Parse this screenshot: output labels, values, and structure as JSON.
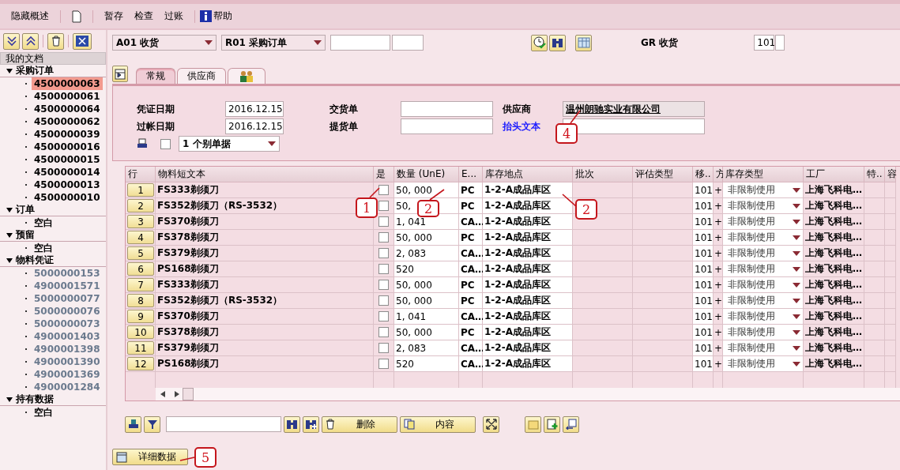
{
  "toolbar": {
    "hide_overview": "隐藏概述",
    "hold": "暂存",
    "check": "检查",
    "post": "过账",
    "help": "帮助"
  },
  "sidebar": {
    "title": "我的文档",
    "sections": [
      {
        "label": "采购订单",
        "expanded": true,
        "muted": false,
        "items": [
          {
            "label": "4500000063",
            "selected": true
          },
          {
            "label": "4500000061",
            "selected": false
          },
          {
            "label": "4500000064",
            "selected": false
          },
          {
            "label": "4500000062",
            "selected": false
          },
          {
            "label": "4500000039",
            "selected": false
          },
          {
            "label": "4500000016",
            "selected": false
          },
          {
            "label": "4500000015",
            "selected": false
          },
          {
            "label": "4500000014",
            "selected": false
          },
          {
            "label": "4500000013",
            "selected": false
          },
          {
            "label": "4500000010",
            "selected": false
          }
        ]
      },
      {
        "label": "订单",
        "expanded": true,
        "muted": false,
        "items": [
          {
            "label": "空白",
            "selected": false
          }
        ]
      },
      {
        "label": "预留",
        "expanded": true,
        "muted": false,
        "items": [
          {
            "label": "空白",
            "selected": false
          }
        ]
      },
      {
        "label": "物料凭证",
        "expanded": true,
        "muted": true,
        "items": [
          {
            "label": "5000000153",
            "selected": false
          },
          {
            "label": "4900001571",
            "selected": false
          },
          {
            "label": "5000000077",
            "selected": false
          },
          {
            "label": "5000000076",
            "selected": false
          },
          {
            "label": "5000000073",
            "selected": false
          },
          {
            "label": "4900001403",
            "selected": false
          },
          {
            "label": "4900001398",
            "selected": false
          },
          {
            "label": "4900001390",
            "selected": false
          },
          {
            "label": "4900001369",
            "selected": false
          },
          {
            "label": "4900001284",
            "selected": false
          }
        ]
      },
      {
        "label": "持有数据",
        "expanded": true,
        "muted": false,
        "items": [
          {
            "label": "空白",
            "selected": false
          }
        ]
      }
    ]
  },
  "header_bar": {
    "action": "A01 收货",
    "reference": "R01 采购订单",
    "gr_label": "GR 收货",
    "movement_type": "101"
  },
  "tabs": [
    {
      "kind": "text",
      "label": "常规",
      "selected": true
    },
    {
      "kind": "text",
      "label": "供应商",
      "selected": false
    },
    {
      "kind": "icon",
      "selected": false
    }
  ],
  "general": {
    "doc_date_label": "凭证日期",
    "doc_date": "2016.12.15",
    "post_date_label": "过帐日期",
    "post_date": "2016.12.15",
    "slip_checked": false,
    "slip_option": "1 个别单据",
    "delivery_note_label": "交货单",
    "bill_of_lading_label": "提货单",
    "vendor_label": "供应商",
    "vendor": "温州朗驰实业有限公司",
    "header_text_label": "抬头文本"
  },
  "table": {
    "columns": [
      "行",
      "物料短文本",
      "是",
      "数量 (UnE)",
      "E...",
      "库存地点",
      "批次",
      "评估类型",
      "移..",
      "方",
      "库存类型",
      "工厂",
      "特..",
      "容"
    ],
    "rows": [
      {
        "line": "1",
        "material": "FS333剃须刀",
        "ok": false,
        "qty": "50, 000",
        "unit": "PC",
        "location": "1-2-A成品库区",
        "movement": "101",
        "sign": "+",
        "stock_type": "非限制使用",
        "plant": "上海飞科电…"
      },
      {
        "line": "2",
        "material": "FS352剃须刀（RS-3532）",
        "ok": false,
        "qty": "50,",
        "unit": "PC",
        "location": "1-2-A成品库区",
        "movement": "101",
        "sign": "+",
        "stock_type": "非限制使用",
        "plant": "上海飞科电…"
      },
      {
        "line": "3",
        "material": "FS370剃须刀",
        "ok": false,
        "qty": "1, 041",
        "unit": "CA…",
        "location": "1-2-A成品库区",
        "movement": "101",
        "sign": "+",
        "stock_type": "非限制使用",
        "plant": "上海飞科电…"
      },
      {
        "line": "4",
        "material": "FS378剃须刀",
        "ok": false,
        "qty": "50, 000",
        "unit": "PC",
        "location": "1-2-A成品库区",
        "movement": "101",
        "sign": "+",
        "stock_type": "非限制使用",
        "plant": "上海飞科电…"
      },
      {
        "line": "5",
        "material": "FS379剃须刀",
        "ok": false,
        "qty": "2, 083",
        "unit": "CA…",
        "location": "1-2-A成品库区",
        "movement": "101",
        "sign": "+",
        "stock_type": "非限制使用",
        "plant": "上海飞科电…"
      },
      {
        "line": "6",
        "material": "PS168剃须刀",
        "ok": false,
        "qty": "520",
        "unit": "CA…",
        "location": "1-2-A成品库区",
        "movement": "101",
        "sign": "+",
        "stock_type": "非限制使用",
        "plant": "上海飞科电…"
      },
      {
        "line": "7",
        "material": "FS333剃须刀",
        "ok": false,
        "qty": "50, 000",
        "unit": "PC",
        "location": "1-2-A成品库区",
        "movement": "101",
        "sign": "+",
        "stock_type": "非限制使用",
        "plant": "上海飞科电…"
      },
      {
        "line": "8",
        "material": "FS352剃须刀（RS-3532）",
        "ok": false,
        "qty": "50, 000",
        "unit": "PC",
        "location": "1-2-A成品库区",
        "movement": "101",
        "sign": "+",
        "stock_type": "非限制使用",
        "plant": "上海飞科电…"
      },
      {
        "line": "9",
        "material": "FS370剃须刀",
        "ok": false,
        "qty": "1, 041",
        "unit": "CA…",
        "location": "1-2-A成品库区",
        "movement": "101",
        "sign": "+",
        "stock_type": "非限制使用",
        "plant": "上海飞科电…"
      },
      {
        "line": "10",
        "material": "FS378剃须刀",
        "ok": false,
        "qty": "50, 000",
        "unit": "PC",
        "location": "1-2-A成品库区",
        "movement": "101",
        "sign": "+",
        "stock_type": "非限制使用",
        "plant": "上海飞科电…"
      },
      {
        "line": "11",
        "material": "FS379剃须刀",
        "ok": false,
        "qty": "2, 083",
        "unit": "CA…",
        "location": "1-2-A成品库区",
        "movement": "101",
        "sign": "+",
        "stock_type": "非限制使用",
        "plant": "上海飞科电…"
      },
      {
        "line": "12",
        "material": "PS168剃须刀",
        "ok": false,
        "qty": "520",
        "unit": "CA…",
        "location": "1-2-A成品库区",
        "movement": "101",
        "sign": "+",
        "stock_type": "非限制使用",
        "plant": "上海飞科电…"
      }
    ]
  },
  "item_toolbar": {
    "delete": "删除",
    "contents": "内容"
  },
  "detail_button": "详细数据",
  "annotations": [
    "1",
    "2",
    "2",
    "4",
    "5"
  ]
}
